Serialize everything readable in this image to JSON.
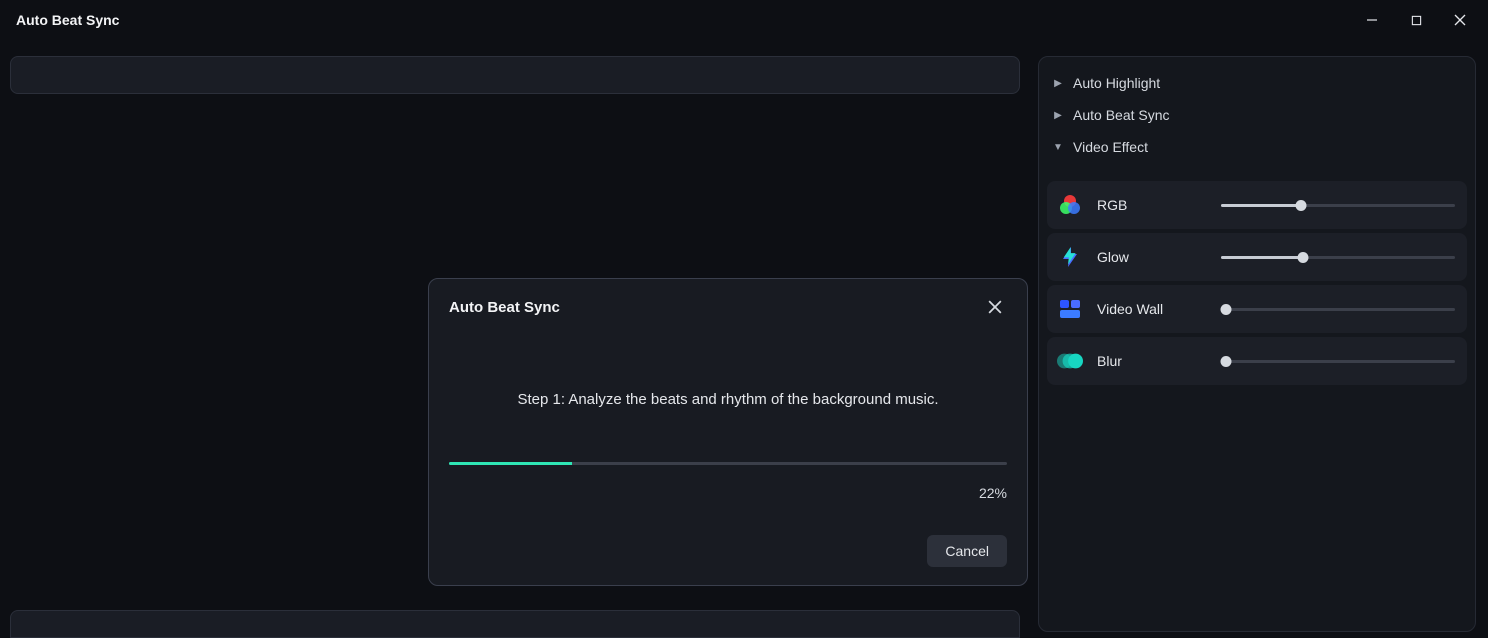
{
  "window": {
    "title": "Auto Beat Sync"
  },
  "sidebar": {
    "tree": [
      {
        "label": "Auto Highlight",
        "expanded": false
      },
      {
        "label": "Auto Beat Sync",
        "expanded": false
      },
      {
        "label": "Video Effect",
        "expanded": true
      }
    ],
    "effects": [
      {
        "id": "rgb",
        "label": "RGB",
        "value": 34,
        "icon": "rgb-icon"
      },
      {
        "id": "glow",
        "label": "Glow",
        "value": 35,
        "icon": "glow-icon"
      },
      {
        "id": "videowall",
        "label": "Video Wall",
        "value": 2,
        "icon": "videowall-icon"
      },
      {
        "id": "blur",
        "label": "Blur",
        "value": 2,
        "icon": "blur-icon"
      }
    ]
  },
  "dialog": {
    "title": "Auto Beat Sync",
    "message": "Step 1: Analyze the beats and rhythm of the background music.",
    "progress": 22,
    "progress_label": "22%",
    "cancel_label": "Cancel"
  }
}
